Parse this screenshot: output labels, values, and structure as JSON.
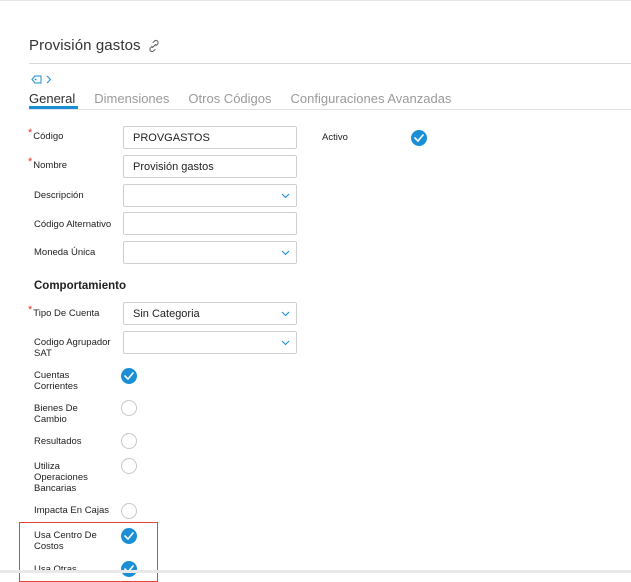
{
  "header": {
    "title": "Provisión gastos"
  },
  "tabs": [
    {
      "label": "General"
    },
    {
      "label": "Dimensiones"
    },
    {
      "label": "Otros Códigos"
    },
    {
      "label": "Configuraciones Avanzadas"
    }
  ],
  "form": {
    "codigo": {
      "label": "Código",
      "value": "PROVGASTOS"
    },
    "nombre": {
      "label": "Nombre",
      "value": "Provisión gastos"
    },
    "descripcion": {
      "label": "Descripción",
      "value": ""
    },
    "codigo_alternativo": {
      "label": "Código Alternativo",
      "value": ""
    },
    "moneda_unica": {
      "label": "Moneda Única",
      "value": ""
    },
    "activo": {
      "label": "Activo",
      "checked": true
    }
  },
  "comportamiento": {
    "title": "Comportamiento",
    "tipo_cuenta": {
      "label": "Tipo De Cuenta",
      "value": "Sin Categoria"
    },
    "codigo_agrupador": {
      "label": "Codigo Agrupador SAT",
      "value": ""
    },
    "cuentas_corrientes": {
      "label": "Cuentas Corrientes",
      "checked": true
    },
    "bienes_cambio": {
      "label": "Bienes De Cambio",
      "checked": false
    },
    "resultados": {
      "label": "Resultados",
      "checked": false
    },
    "operaciones_bancarias": {
      "label": "Utiliza Operaciones Bancarias",
      "checked": false
    },
    "impacta_cajas": {
      "label": "Impacta En Cajas",
      "checked": false
    },
    "centro_costos": {
      "label": "Usa Centro De Costos",
      "checked": true
    },
    "usa_otras": {
      "label": "Usa Otras",
      "checked": true
    }
  },
  "colors": {
    "accent": "#1a8fd6",
    "required": "#e5332a",
    "highlight": "#e0453a"
  }
}
